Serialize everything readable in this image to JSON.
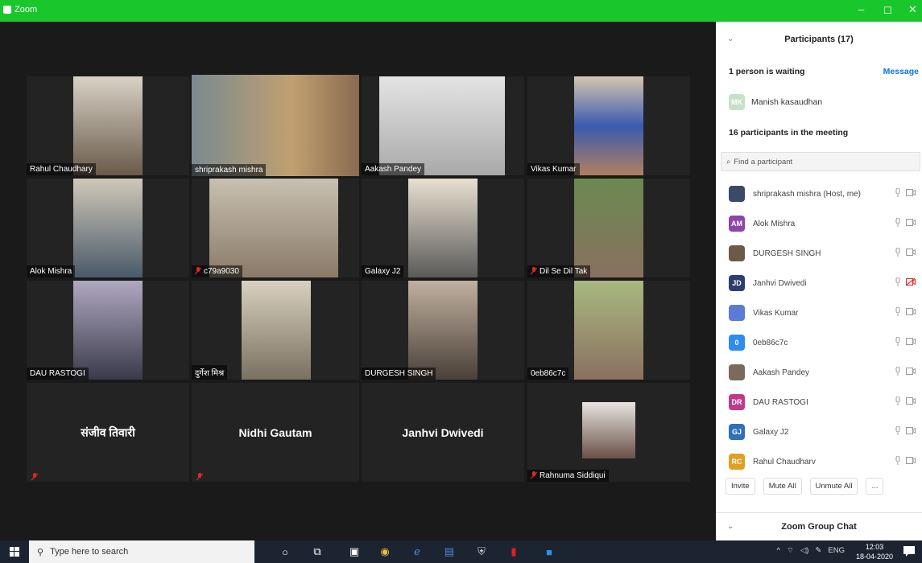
{
  "window": {
    "title": "Zoom",
    "minimize": "–",
    "maximize": "◻",
    "close": "✕"
  },
  "video_tiles": [
    {
      "name": "Rahul Chaudhary",
      "muted": false,
      "active": false
    },
    {
      "name": "shriprakash mishra",
      "muted": false,
      "active": true
    },
    {
      "name": "Aakash Pandey",
      "muted": false,
      "active": false
    },
    {
      "name": "Vikas Kumar",
      "muted": false,
      "active": false
    },
    {
      "name": "Alok Mishra",
      "muted": false,
      "active": false
    },
    {
      "name": "c79a9030",
      "muted": true,
      "active": false
    },
    {
      "name": "Galaxy J2",
      "muted": false,
      "active": false
    },
    {
      "name": "Dil Se Dil Tak",
      "muted": true,
      "active": false
    },
    {
      "name": "DAU RASTOGI",
      "muted": false,
      "active": false
    },
    {
      "name": "दुर्गेश मिश्र",
      "muted": false,
      "active": false
    },
    {
      "name": "DURGESH SINGH",
      "muted": false,
      "active": false
    },
    {
      "name": "0eb86c7c",
      "muted": false,
      "active": false
    },
    {
      "name": "संजीव तिवारी",
      "muted": true,
      "video_off": true
    },
    {
      "name": "Nidhi Gautam",
      "muted": true,
      "video_off": true
    },
    {
      "name": "Janhvi Dwivedi",
      "muted": false,
      "video_off": true
    },
    {
      "name": "Rahnuma Siddiqui",
      "muted": true,
      "active": false
    }
  ],
  "participants_panel": {
    "title": "Participants (17)",
    "waiting_text": "1 person is waiting",
    "message_label": "Message",
    "waiting_user": {
      "name": "Manish kasaudhan",
      "initials": "MK"
    },
    "in_meeting_text": "16 participants in the meeting",
    "search_placeholder": "Find a participant",
    "participants": [
      {
        "name": "shriprakash mishra (Host, me)",
        "initials": "",
        "color": "#3b4a6b",
        "video_off": false
      },
      {
        "name": "Alok Mishra",
        "initials": "AM",
        "color": "#8e44ad",
        "video_off": false
      },
      {
        "name": "DURGESH SINGH",
        "initials": "",
        "color": "#6b5a4a",
        "video_off": false
      },
      {
        "name": "Janhvi Dwivedi",
        "initials": "JD",
        "color": "#2c3e6b",
        "video_off": true
      },
      {
        "name": "Vikas Kumar",
        "initials": "",
        "color": "#5b7bd5",
        "video_off": false
      },
      {
        "name": "0eb86c7c",
        "initials": "0",
        "color": "#2d8cf0",
        "video_off": false
      },
      {
        "name": "Aakash Pandey",
        "initials": "",
        "color": "#7a6a5a",
        "video_off": false
      },
      {
        "name": "DAU RASTOGI",
        "initials": "DR",
        "color": "#c0398e",
        "video_off": false
      },
      {
        "name": "Galaxy J2",
        "initials": "GJ",
        "color": "#2e6fbf",
        "video_off": false
      },
      {
        "name": "Rahul Chaudharv",
        "initials": "RC",
        "color": "#e0a020",
        "video_off": false
      }
    ],
    "actions": {
      "invite": "Invite",
      "mute_all": "Mute All",
      "unmute_all": "Unmute All",
      "more": "..."
    },
    "chat_title": "Zoom Group Chat"
  },
  "taskbar": {
    "search_placeholder": "Type here to search",
    "language": "ENG",
    "time": "12:03",
    "date": "18-04-2020"
  },
  "colors": {
    "title_bar": "#19c72c",
    "accent": "#0e72ed",
    "active_speaker": "#c8e26b",
    "mute": "#e02828"
  }
}
